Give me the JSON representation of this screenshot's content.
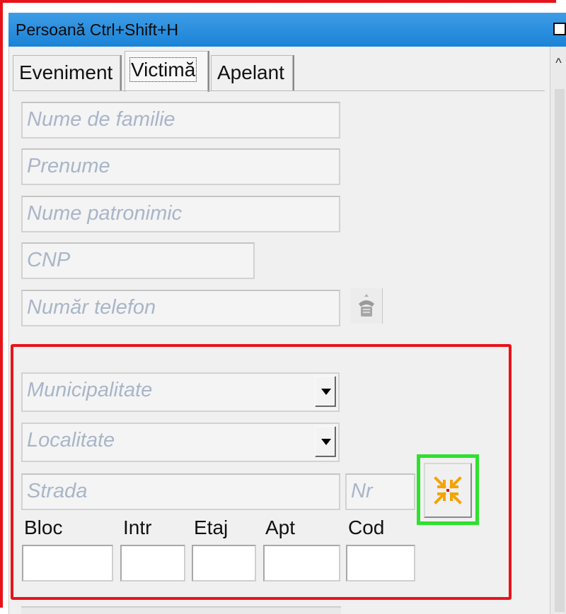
{
  "window": {
    "title": "Persoană Ctrl+Shift+H"
  },
  "tabs": [
    {
      "label": "Eveniment",
      "active": false
    },
    {
      "label": "Victimă",
      "active": true
    },
    {
      "label": "Apelant",
      "active": false
    }
  ],
  "person": {
    "last_name_placeholder": "Nume de familie",
    "first_name_placeholder": "Prenume",
    "patronymic_placeholder": "Nume patronimic",
    "cnp_placeholder": "CNP",
    "phone_placeholder": "Număr telefon",
    "phone_button_icon": "telephone-icon"
  },
  "address": {
    "municipality_placeholder": "Municipalitate",
    "locality_placeholder": "Localitate",
    "street_placeholder": "Strada",
    "number_placeholder": "Nr",
    "locate_button_icon": "collapse-arrows-icon",
    "labels": {
      "bloc": "Bloc",
      "intr": "Intr",
      "etaj": "Etaj",
      "apt": "Apt",
      "cod": "Cod"
    },
    "values": {
      "bloc": "",
      "intr": "",
      "etaj": "",
      "apt": "",
      "cod": ""
    }
  },
  "colors": {
    "titlebar": "#1a83d6",
    "highlight_red": "#e8131a",
    "highlight_green": "#2fe02f",
    "placeholder_text": "#a9b5c8",
    "icon_orange": "#f5a300"
  }
}
